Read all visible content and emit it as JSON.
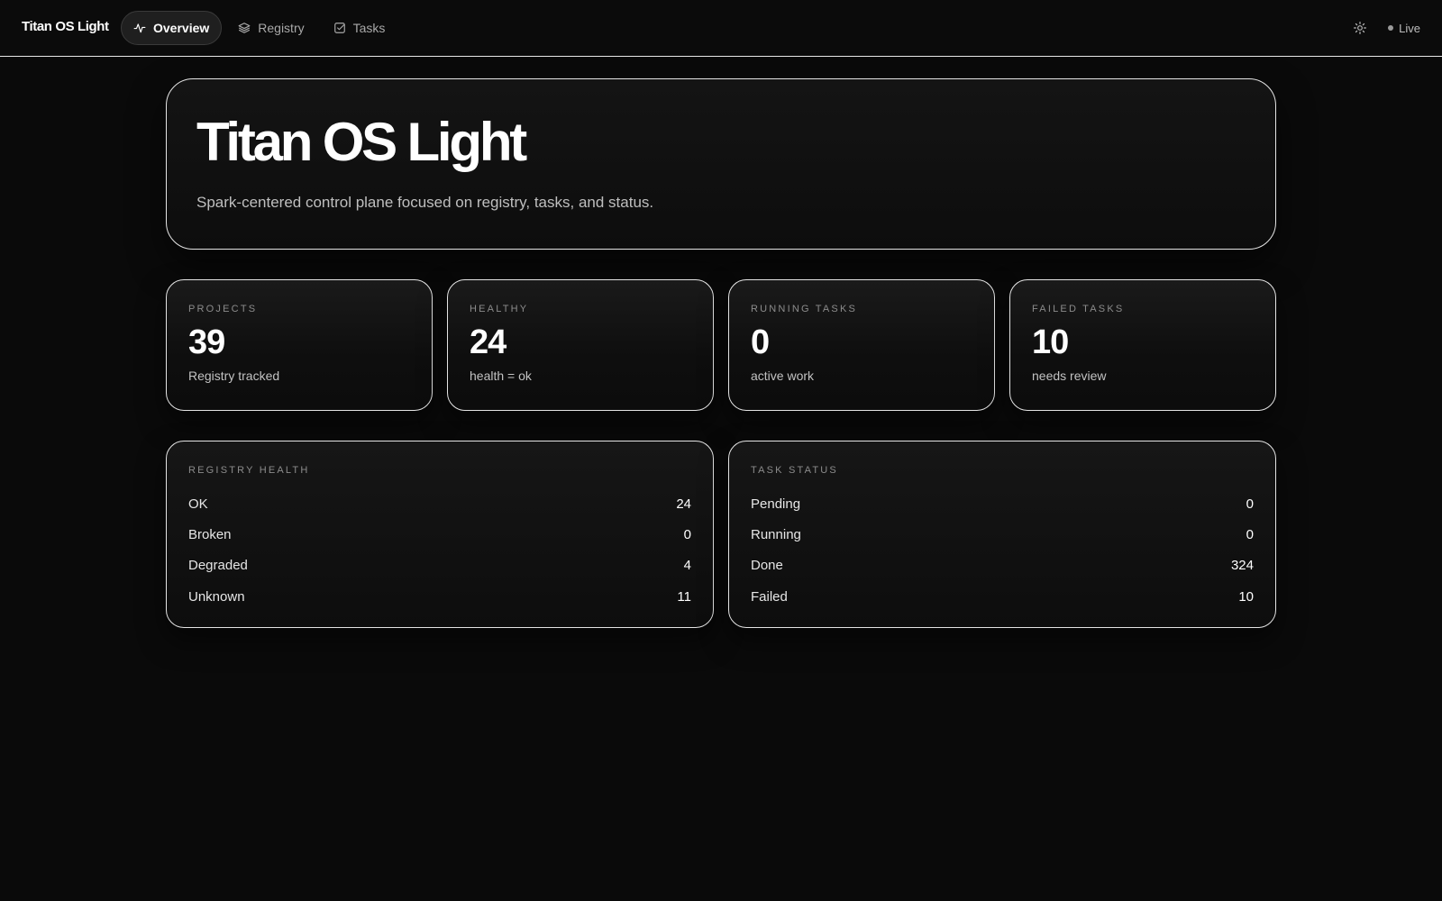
{
  "app": {
    "brand": "Titan OS Light"
  },
  "nav": {
    "items": [
      {
        "label": "Overview",
        "icon": "activity-icon",
        "active": true
      },
      {
        "label": "Registry",
        "icon": "layers-icon",
        "active": false
      },
      {
        "label": "Tasks",
        "icon": "checkbox-icon",
        "active": false
      }
    ]
  },
  "status": {
    "live_label": "Live",
    "theme_icon": "sun-icon"
  },
  "hero": {
    "title": "Titan OS Light",
    "subtitle": "Spark-centered control plane focused on registry, tasks, and status."
  },
  "stats": [
    {
      "label": "PROJECTS",
      "value": "39",
      "sub": "Registry tracked"
    },
    {
      "label": "HEALTHY",
      "value": "24",
      "sub": "health = ok"
    },
    {
      "label": "RUNNING TASKS",
      "value": "0",
      "sub": "active work"
    },
    {
      "label": "FAILED TASKS",
      "value": "10",
      "sub": "needs review"
    }
  ],
  "registry_health": {
    "title": "REGISTRY HEALTH",
    "rows": [
      {
        "label": "OK",
        "value": "24"
      },
      {
        "label": "Broken",
        "value": "0"
      },
      {
        "label": "Degraded",
        "value": "4"
      },
      {
        "label": "Unknown",
        "value": "11"
      }
    ]
  },
  "task_status": {
    "title": "TASK STATUS",
    "rows": [
      {
        "label": "Pending",
        "value": "0"
      },
      {
        "label": "Running",
        "value": "0"
      },
      {
        "label": "Done",
        "value": "324"
      },
      {
        "label": "Failed",
        "value": "10"
      }
    ]
  },
  "colors": {
    "background": "#0a0a0a",
    "border": "#e4e4e4",
    "text": "#ffffff",
    "muted": "#8c8c8c"
  }
}
